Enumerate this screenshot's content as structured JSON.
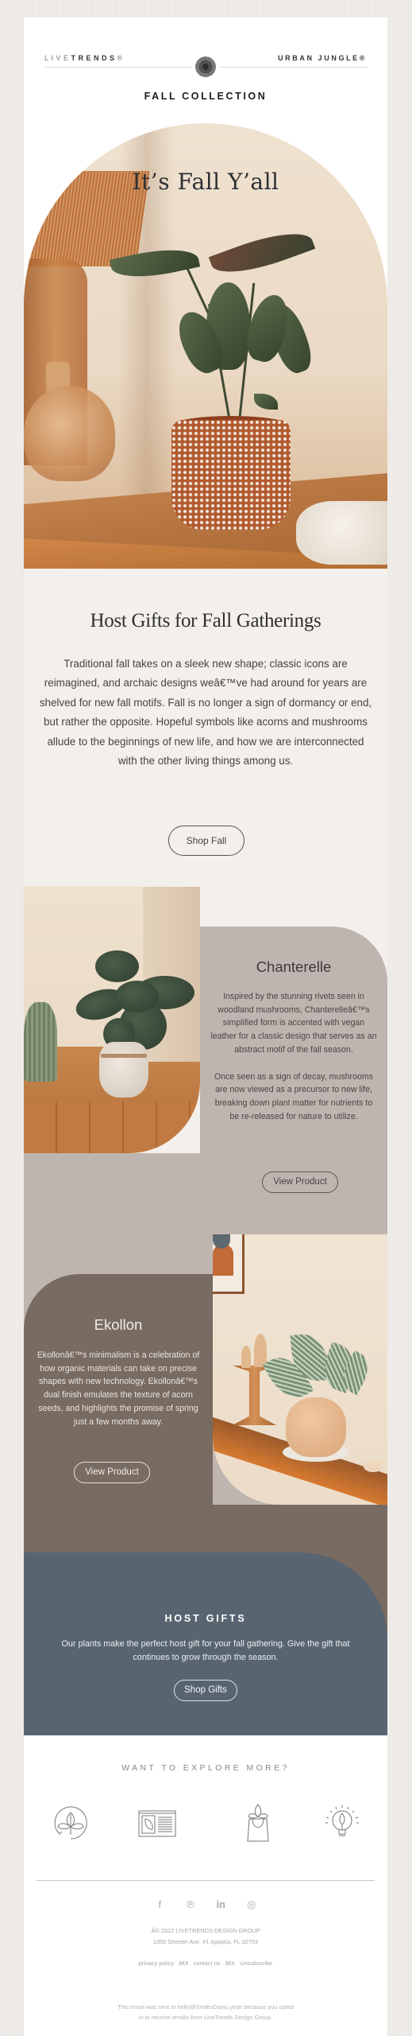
{
  "header": {
    "brand_left_light": "LIVE",
    "brand_left_bold": "TRENDS",
    "brand_left_mark": "®",
    "brand_right": "URBAN JUNGLE®",
    "collection_title": "FALL COLLECTION"
  },
  "hero": {
    "title": "It’s Fall Y’all"
  },
  "intro": {
    "title": "Host Gifts for Fall Gatherings",
    "body": "Traditional fall takes on a sleek new shape; classic icons are reimagined, and archaic designs weâ€™ve had around for years are shelved for new fall motifs. Fall is no longer a sign of dormancy or end, but rather the opposite. Hopeful symbols like acorns and mushrooms allude to the beginnings of new life, and how we are interconnected with the other living things among us.",
    "button_label": "Shop Fall"
  },
  "products": [
    {
      "name": "Chanterelle",
      "paragraphs": [
        "Inspired by the stunning rivets seen in woodland mushrooms, Chanterelleâ€™s simplified form is accented with vegan leather for a classic design that serves as an abstract motif of the fall season.",
        "Once seen as a sign of decay, mushrooms are now viewed as a precursor to new life, breaking down plant matter for nutrients to be re-released for nature to utilize."
      ],
      "button_label": "View Product",
      "panel_color": "#bfb5b0"
    },
    {
      "name": "Ekollon",
      "paragraphs": [
        "Ekollonâ€™s minimalism is a celebration of how organic materials can take on precise shapes with new technology. Ekollonâ€™s dual finish emulates the texture of acorn seeds, and highlights the promise of spring just a few months away."
      ],
      "button_label": "View Product",
      "panel_color": "#776b62"
    }
  ],
  "host_gifts": {
    "title": "HOST GIFTS",
    "body": "Our plants make the perfect host gift for your fall gathering. Give the gift that continues to grow through the season.",
    "button_label": "Shop Gifts",
    "panel_color": "#586570"
  },
  "explore": {
    "title": "WANT TO EXPLORE MORE?",
    "icons": [
      "plant-care-icon",
      "plant-guide-icon",
      "shop-bag-icon",
      "ideas-lightbulb-icon"
    ]
  },
  "footer": {
    "social": [
      {
        "name": "facebook-icon",
        "glyph": "f"
      },
      {
        "name": "pinterest-icon",
        "glyph": "℗"
      },
      {
        "name": "linkedin-icon",
        "glyph": "in"
      },
      {
        "name": "instagram-icon",
        "glyph": "◎"
      }
    ],
    "copyright": "Â© 2022 LIVETRENDS DESIGN GROUP",
    "address": "1350 Sheeler Ave. #1 Apopka, FL 32703",
    "links": [
      "privacy policy",
      "â€¢",
      "contact us",
      "â€¢",
      "Unsubscribe"
    ],
    "sent_line1": "This email was sent to hello@SmilesDavis.yeah because you opted",
    "sent_line2": "in to receive emails from LiveTrends Design Group."
  }
}
